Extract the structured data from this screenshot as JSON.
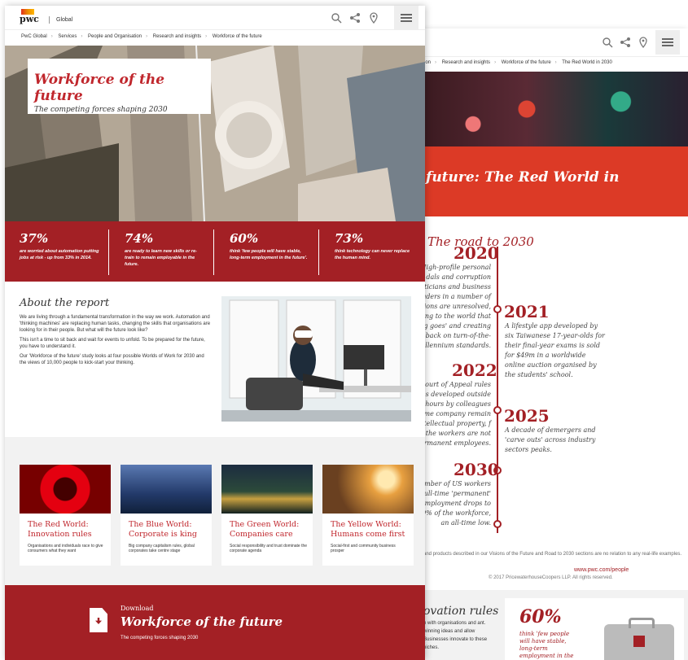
{
  "brand": {
    "logo": "pwc",
    "region": "Global",
    "accent": "#a32025"
  },
  "front": {
    "breadcrumb": [
      "PwC Global",
      "Services",
      "People and Organisation",
      "Research and insights",
      "Workforce of the future"
    ],
    "hero": {
      "title": "Workforce of the future",
      "subtitle": "The competing forces shaping 2030"
    },
    "stats": [
      {
        "value": "37%",
        "text": "are worried about automation putting jobs at risk - up from 33% in 2014."
      },
      {
        "value": "74%",
        "text": "are ready to learn new skills or re-train to remain employable in the future."
      },
      {
        "value": "60%",
        "text": "think 'few people will have stable, long-term employment in the future'."
      },
      {
        "value": "73%",
        "text": "think technology can never replace the human mind."
      }
    ],
    "about": {
      "heading": "About the report",
      "paragraphs": [
        "We are living through a fundamental transformation in the way we work. Automation and 'thinking machines' are replacing human tasks, changing the skills that organisations are looking for in their people. But what will the future look like?",
        "This isn't a time to sit back and wait for events to unfold. To be prepared for the future, you have to understand it.",
        "Our 'Workforce of the future' study looks at four possible Worlds of Work for 2030 and the views of 10,000 people to kick-start your thinking."
      ]
    },
    "worlds": [
      {
        "title": "The Red World: Innovation rules",
        "text": "Organisations and individuals race to give consumers what they want"
      },
      {
        "title": "The Blue World: Corporate is king",
        "text": "Big company capitalism rules, global corporates take centre stage"
      },
      {
        "title": "The Green World: Companies care",
        "text": "Social responsibility and trust dominate the corporate agenda"
      },
      {
        "title": "The Yellow World: Humans come first",
        "text": "Social-first and community business prosper"
      }
    ],
    "download": {
      "label": "Download",
      "title": "Workforce of the future",
      "subtitle": "The competing forces shaping 2030"
    }
  },
  "back": {
    "breadcrumb": [
      "ion",
      "Research and insights",
      "Workforce of the future",
      "The Red World in 2030"
    ],
    "banner_title": "future: The Red World in",
    "road_title": "The road to 2030",
    "timeline": [
      {
        "year": "2020",
        "text": "High-profile personal dals and corruption iticians and business aders in a number of ions are unresolved, ing to the world that g goes' and creating back on turn-of-the-llennium standards."
      },
      {
        "year": "2021",
        "text": "A lifestyle app developed by six Taiwanese 17-year-olds for their final-year exams is sold for $49m in a worldwide online auction organised by the students' school."
      },
      {
        "year": "2022",
        "text": "Court of Appeal rules as developed outside hours by colleagues me company remain ntellectual property, f the workers are not rmanent employees."
      },
      {
        "year": "2025",
        "text": "A decade of demergers and 'carve outs' across industry sectors peaks."
      },
      {
        "year": "2030",
        "text": "umber of US workers ull-time 'permanent' employment drops to 9% of the workforce, an all-time low."
      }
    ],
    "footnote": "and products described in our Visions of the Future and Road to 2030 sections are no relation to any real-life examples.",
    "site": "www.pwc.com/people",
    "copyright": "© 2017 PricewaterhouseCoopers LLP. All rights reserved.",
    "innovation_heading": "ovation rules",
    "innovation_text": "n with organisations and ant. winning ideas and allow Businesses innovate to these niches.",
    "stat": {
      "value": "60%",
      "text": "think 'few people will have stable, long-term employment in the"
    }
  }
}
